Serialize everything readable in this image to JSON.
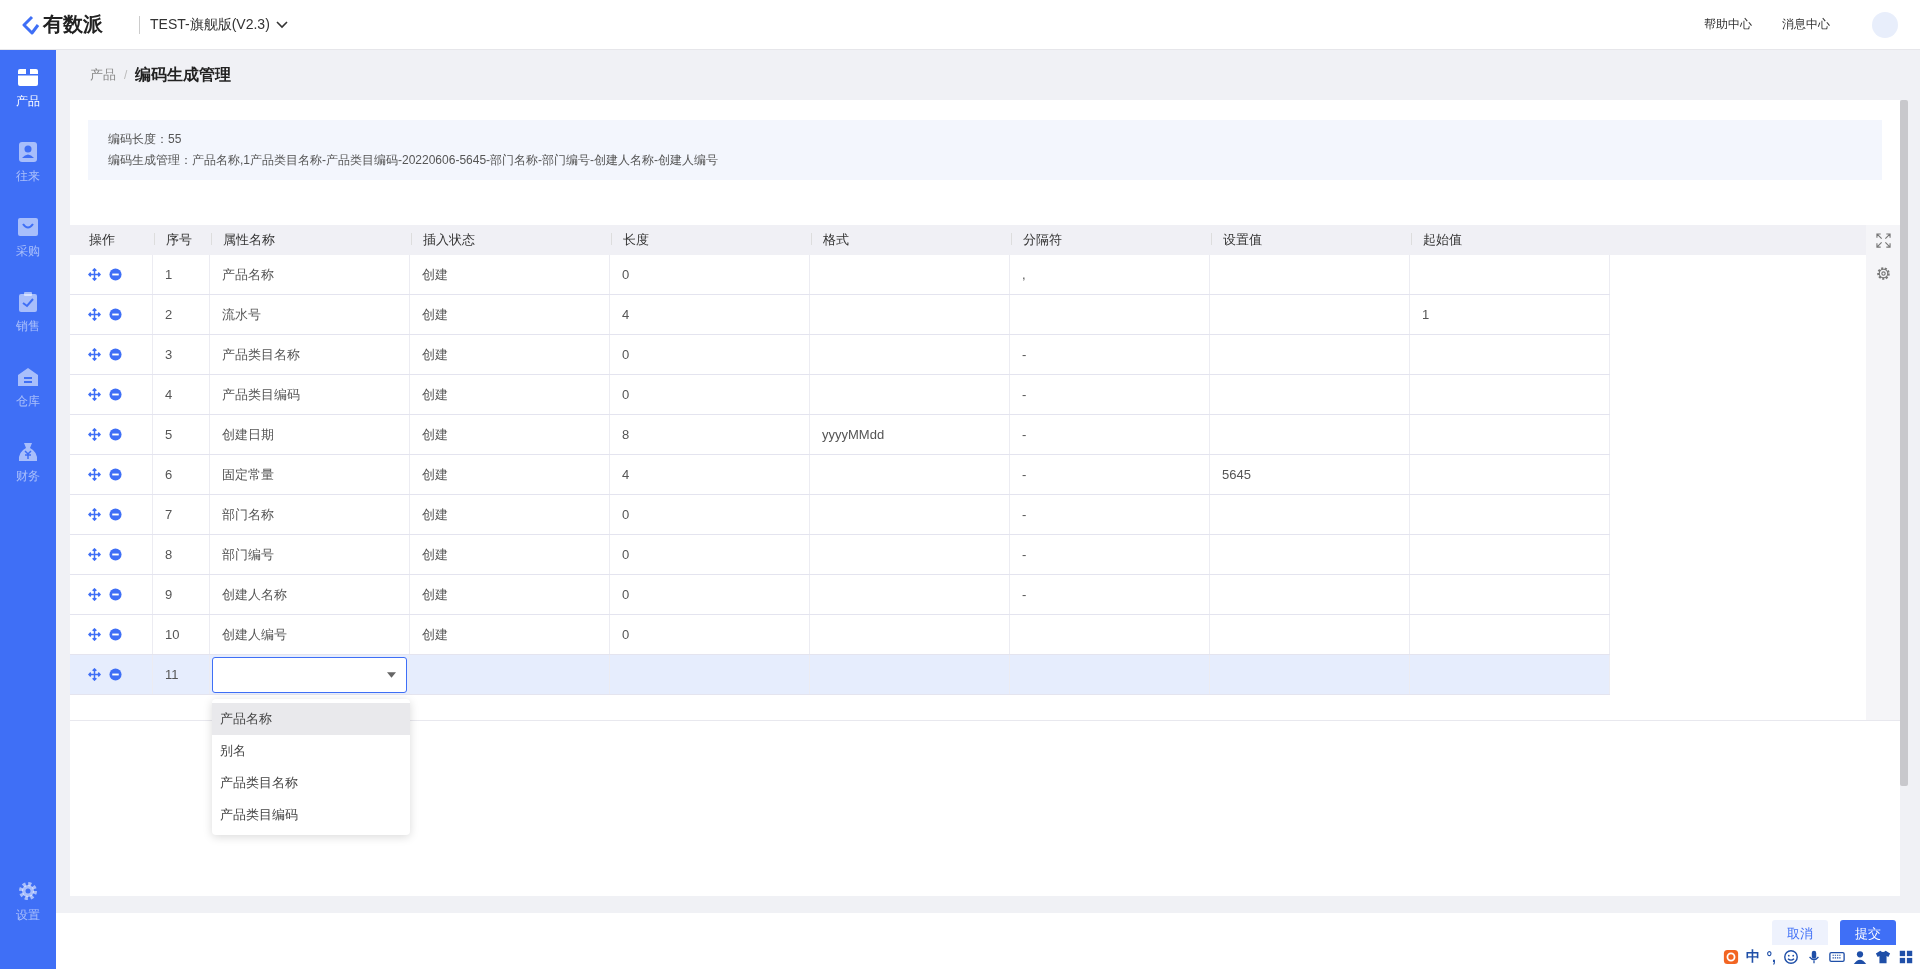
{
  "header": {
    "brand": "有数派",
    "workspace": "TEST-旗舰版(V2.3)",
    "links": [
      "帮助中心",
      "消息中心"
    ]
  },
  "sidebar": {
    "items": [
      {
        "label": "产品",
        "selected": true
      },
      {
        "label": "往来",
        "selected": false
      },
      {
        "label": "采购",
        "selected": false
      },
      {
        "label": "销售",
        "selected": false
      },
      {
        "label": "仓库",
        "selected": false
      },
      {
        "label": "财务",
        "selected": false
      }
    ],
    "settings": "设置"
  },
  "breadcrumb": [
    "产品",
    "/",
    "编码生成管理"
  ],
  "info": [
    "编码长度：55",
    "编码生成管理：产品名称,1产品类目名称-产品类目编码-20220606-5645-部门名称-部门编号-创建人名称-创建人编号"
  ],
  "table": {
    "columns": [
      "操作",
      "序号",
      "属性名称",
      "插入状态",
      "长度",
      "格式",
      "分隔符",
      "设置值",
      "起始值"
    ],
    "rows": [
      {
        "kind": "row",
        "selected": false,
        "cells": [
          "",
          "1",
          "产品名称",
          "创建",
          "0",
          "",
          ",",
          "",
          ""
        ]
      },
      {
        "kind": "row",
        "selected": false,
        "cells": [
          "",
          "2",
          "流水号",
          "创建",
          "4",
          "",
          "",
          "",
          "1"
        ]
      },
      {
        "kind": "row",
        "selected": false,
        "cells": [
          "",
          "3",
          "产品类目名称",
          "创建",
          "0",
          "",
          "-",
          "",
          ""
        ]
      },
      {
        "kind": "row",
        "selected": false,
        "cells": [
          "",
          "4",
          "产品类目编码",
          "创建",
          "0",
          "",
          "-",
          "",
          ""
        ]
      },
      {
        "kind": "row",
        "selected": false,
        "cells": [
          "",
          "5",
          "创建日期",
          "创建",
          "8",
          "yyyyMMdd",
          "-",
          "",
          ""
        ]
      },
      {
        "kind": "row",
        "selected": false,
        "cells": [
          "",
          "6",
          "固定常量",
          "创建",
          "4",
          "",
          "-",
          "5645",
          ""
        ]
      },
      {
        "kind": "row",
        "selected": false,
        "cells": [
          "",
          "7",
          "部门名称",
          "创建",
          "0",
          "",
          "-",
          "",
          ""
        ]
      },
      {
        "kind": "row",
        "selected": false,
        "cells": [
          "",
          "8",
          "部门编号",
          "创建",
          "0",
          "",
          "-",
          "",
          ""
        ]
      },
      {
        "kind": "row",
        "selected": false,
        "cells": [
          "",
          "9",
          "创建人名称",
          "创建",
          "0",
          "",
          "-",
          "",
          ""
        ]
      },
      {
        "kind": "row",
        "selected": false,
        "cells": [
          "",
          "10",
          "创建人编号",
          "创建",
          "0",
          "",
          "",
          "",
          ""
        ]
      },
      {
        "kind": "editing",
        "selected": true,
        "cells": [
          "",
          "11"
        ]
      }
    ],
    "dropdown": {
      "options": [
        {
          "label": "产品名称",
          "selected": true
        },
        {
          "label": "别名",
          "selected": false
        },
        {
          "label": "产品类目名称",
          "selected": false
        },
        {
          "label": "产品类目编码",
          "selected": false
        }
      ]
    }
  },
  "footer": {
    "buttons": [
      "取消",
      "提交"
    ]
  },
  "ime_bar": {
    "mode": "中",
    "punct": "°,"
  }
}
